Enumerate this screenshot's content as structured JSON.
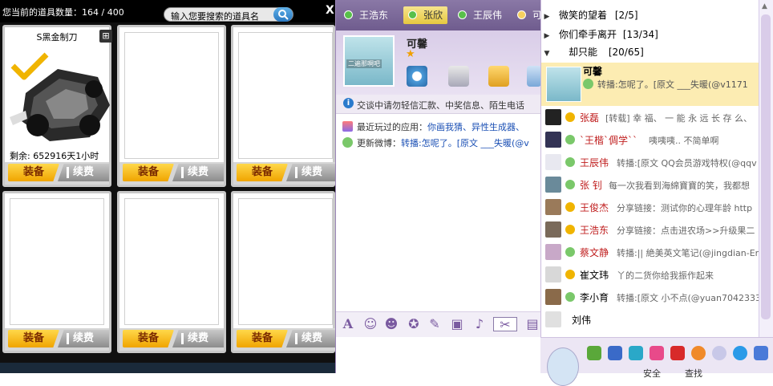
{
  "inventory": {
    "count_label": "您当前的道具数量：164 / 400",
    "search_placeholder": "输入您要搜索的道具名",
    "close": "X",
    "item": {
      "name": "S黑金制刀",
      "remaining": "剩余: 652916天1小时"
    },
    "equip_label": "装备",
    "renew_label": "续费"
  },
  "chat": {
    "tabs": [
      "王浩东",
      "张欣",
      "王辰伟",
      "可"
    ],
    "active_tab": 1,
    "contact_name": "可馨",
    "avatar_caption": "二遍那啊吧",
    "notice": "交谈中请勿轻信汇款、中奖信息、陌生电话",
    "recent_app_label": "最近玩过的应用：",
    "recent_app_value": "你画我猜、异性生成器、",
    "weibo_label": "更新微博：",
    "weibo_value": "转播:怎呢了。[原文 ___失暖(@v"
  },
  "contacts": {
    "groups": [
      {
        "name": "微笑的望着",
        "count": "[2/5]"
      },
      {
        "name": "你们牵手离开",
        "count": "[13/34]"
      },
      {
        "name": "却只能",
        "count": "[20/65]"
      }
    ],
    "selected": {
      "name": "可馨",
      "status": "转播:怎呢了。[原文 ___失暖(@v1171"
    },
    "rows": [
      {
        "name": "张磊",
        "status": "[转载] 幸 福、 一 能 永 远 长 存 么、",
        "name_color": "#c02020"
      },
      {
        "name": "`王楷`倜学``",
        "status": "咦咦咦..     不简单啊",
        "name_color": "#c02020"
      },
      {
        "name": "王辰伟",
        "status": "转播:[原文 QQ会员游戏特权(@qqv",
        "name_color": "#c02020"
      },
      {
        "name": "张 钊",
        "status": "每一次我看到海綿寶寶的笑，我都想",
        "name_color": "#c02020"
      },
      {
        "name": "王俊杰",
        "status": "分享链接：测试你的心理年龄 http",
        "name_color": "#c02020"
      },
      {
        "name": "王浩东",
        "status": "分享链接：点击进农场>>升级果二",
        "name_color": "#c02020"
      },
      {
        "name": "蔡文静",
        "status": "转播:|| 絶美英文笔记(@jingdian-En",
        "name_color": "#c02020"
      },
      {
        "name": "崔文玮",
        "status": "丫的二货你给我振作起来",
        "name_color": "#000000"
      },
      {
        "name": "李小育",
        "status": "转播:[原文 小不点(@yuan7042333)",
        "name_color": "#000000"
      },
      {
        "name": "刘伟",
        "status": "",
        "name_color": "#000000"
      }
    ],
    "bottom_labels": [
      "安全",
      "查找"
    ]
  }
}
